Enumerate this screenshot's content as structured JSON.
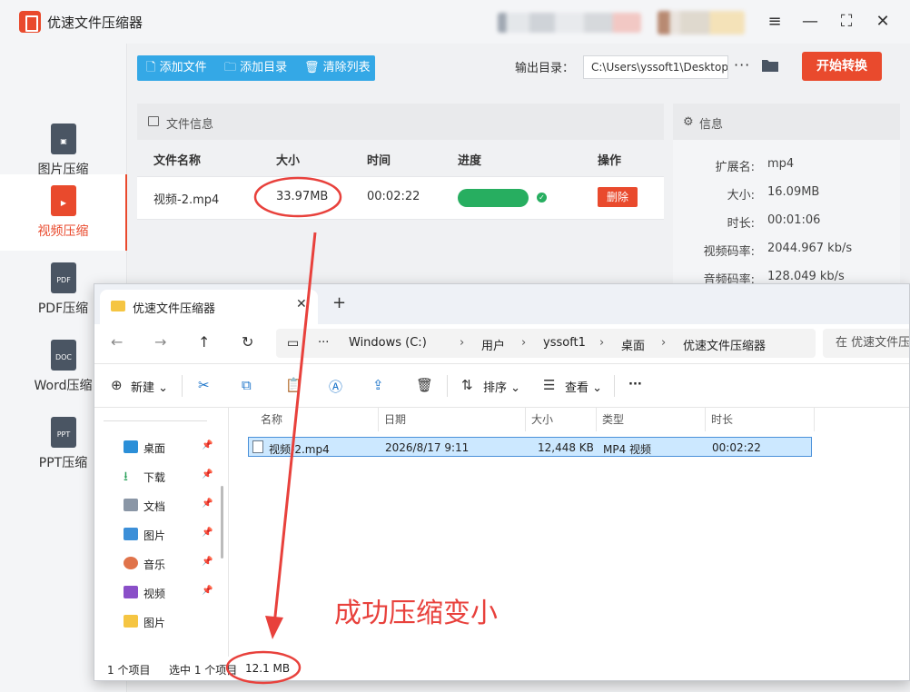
{
  "app": {
    "title": "优速文件压缩器",
    "window_controls": [
      "≡",
      "—",
      "⛶",
      "✕"
    ]
  },
  "sidebar": {
    "items": [
      {
        "label": "图片压缩",
        "icon": "image-file-icon"
      },
      {
        "label": "视频压缩",
        "icon": "video-file-icon",
        "active": true
      },
      {
        "label": "PDF压缩",
        "icon": "pdf-file-icon",
        "badge": "PDF"
      },
      {
        "label": "Word压缩",
        "icon": "word-file-icon",
        "badge": "DOC"
      },
      {
        "label": "PPT压缩",
        "icon": "ppt-file-icon",
        "badge": "PPT"
      }
    ]
  },
  "toolbar": {
    "add_file": "添加文件",
    "add_folder": "添加目录",
    "clear_list": "清除列表",
    "output_label": "输出目录：",
    "output_path": "C:\\Users\\yssoft1\\Desktop",
    "more": "···",
    "start": "开始转换"
  },
  "file_info": {
    "title": "文件信息",
    "columns": [
      "文件名称",
      "大小",
      "时间",
      "进度",
      "操作"
    ],
    "rows": [
      {
        "name": "视频-2.mp4",
        "size": "33.97MB",
        "time": "00:02:22",
        "progress": 1.0,
        "action": "删除"
      }
    ]
  },
  "info": {
    "title": "信息",
    "fields": [
      {
        "key": "扩展名:",
        "value": "mp4"
      },
      {
        "key": "大小:",
        "value": "16.09MB"
      },
      {
        "key": "时长:",
        "value": "00:01:06"
      },
      {
        "key": "视频码率:",
        "value": "2044.967 kb/s"
      },
      {
        "key": "音频码率:",
        "value": "128.049 kb/s"
      }
    ]
  },
  "explorer": {
    "tab_title": "优速文件压缩器",
    "breadcrumb": [
      "Windows (C:)",
      "用户",
      "yssoft1",
      "桌面",
      "优速文件压缩器"
    ],
    "search_placeholder": "在 优速文件压缩器",
    "commands": {
      "new": "新建",
      "sort": "排序",
      "view": "查看",
      "more": "···"
    },
    "nav_pane": [
      {
        "label": "桌面",
        "icon": "desktop-icon",
        "pinned": true
      },
      {
        "label": "下载",
        "icon": "download-icon",
        "pinned": true
      },
      {
        "label": "文档",
        "icon": "document-icon",
        "pinned": true
      },
      {
        "label": "图片",
        "icon": "pictures-icon",
        "pinned": true
      },
      {
        "label": "音乐",
        "icon": "music-icon",
        "pinned": true
      },
      {
        "label": "视频",
        "icon": "videos-icon",
        "pinned": true
      },
      {
        "label": "图片",
        "icon": "folder-icon",
        "pinned": false
      }
    ],
    "columns": [
      "名称",
      "日期",
      "大小",
      "类型",
      "时长"
    ],
    "files": [
      {
        "name": "视频-2.mp4",
        "date": "2026/8/17 9:11",
        "size": "12,448 KB",
        "type": "MP4 视频",
        "duration": "00:02:22"
      }
    ],
    "status": {
      "count": "1 个项目",
      "selected": "选中 1 个项目",
      "size": "12.1 MB"
    }
  },
  "annotation": {
    "text": "成功压缩变小",
    "color": "#e8413c"
  },
  "colors": {
    "brand": "#e94a2d",
    "toolbar_blue": "#34a8e6",
    "progress_green": "#27ae60",
    "selection": "#cce8ff"
  }
}
